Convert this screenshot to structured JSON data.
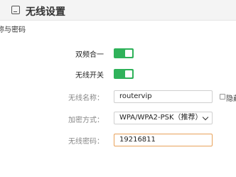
{
  "page": {
    "title": "无线设置",
    "section": "称与密码"
  },
  "settings": {
    "dual_band": {
      "label": "双频合一",
      "on": true
    },
    "wireless": {
      "label": "无线开关",
      "on": true
    },
    "ssid": {
      "label": "无线名称：",
      "value": "routervip",
      "hide_label": "隐藏"
    },
    "encryption": {
      "label": "加密方式：",
      "value": "WPA/WPA2-PSK（推荐）"
    },
    "password": {
      "label": "无线密码：",
      "value": "19216811"
    }
  },
  "colors": {
    "toggle_on": "#2fb25a",
    "focus_border": "#e8a25a"
  }
}
